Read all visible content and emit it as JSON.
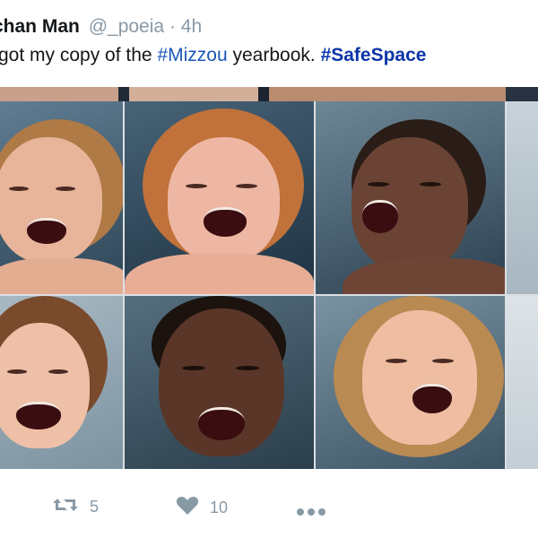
{
  "tweet": {
    "author_name": "chan Man",
    "handle": "@_poeia",
    "separator": "·",
    "time": "4h",
    "text_prefix": "got my copy of the",
    "hashtag1": "#Mizzou",
    "text_middle": "yearbook.",
    "hashtag2": "#SafeSpace"
  },
  "actions": {
    "retweet_count": "5",
    "like_count": "10"
  },
  "icons": [
    "retweet-icon",
    "heart-icon",
    "more-icon"
  ],
  "colors": {
    "link": "#1b57b4",
    "muted": "#8899a6",
    "text": "#14171a"
  }
}
